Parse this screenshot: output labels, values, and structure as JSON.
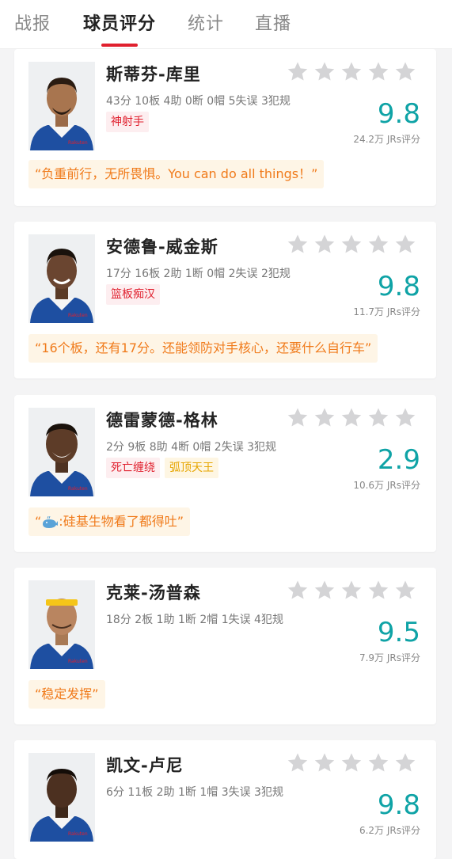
{
  "tabs": [
    {
      "label": "战报"
    },
    {
      "label": "球员评分"
    },
    {
      "label": "统计"
    },
    {
      "label": "直播"
    }
  ],
  "players": [
    {
      "name": "斯蒂芬-库里",
      "stats": "43分 10板 4助 0断 0帽 5失误 3犯规",
      "tags": [
        {
          "text": "神射手",
          "style": "red"
        }
      ],
      "score": "9.8",
      "count": "24.2万 JRs评分",
      "quote": "“负重前行，无所畏惧。You can do all things！”",
      "jersey": "#1e4fa1"
    },
    {
      "name": "安德鲁-威金斯",
      "stats": "17分 16板 2助 1断 0帽 2失误 2犯规",
      "tags": [
        {
          "text": "篮板痴汉",
          "style": "red"
        }
      ],
      "score": "9.8",
      "count": "11.7万 JRs评分",
      "quote": "“16个板，还有17分。还能领防对手核心，还要什么自行车”",
      "jersey": "#1e4fa1"
    },
    {
      "name": "德雷蒙德-格林",
      "stats": "2分 9板 8助 4断 0帽 2失误 3犯规",
      "tags": [
        {
          "text": "死亡缠绕",
          "style": "red"
        },
        {
          "text": "弧顶天王",
          "style": "yellow"
        }
      ],
      "score": "2.9",
      "count": "10.6万 JRs评分",
      "quote": ":硅基生物看了都得吐”",
      "quote_prefix": "“",
      "has_whale": true,
      "jersey": "#1e4fa1"
    },
    {
      "name": "克莱-汤普森",
      "stats": "18分 2板 1助 1断 2帽 1失误 4犯规",
      "tags": [],
      "score": "9.5",
      "count": "7.9万 JRs评分",
      "quote": "“稳定发挥”",
      "jersey": "#1e4fa1"
    },
    {
      "name": "凯文-卢尼",
      "stats": "6分 11板 2助 1断 1帽 3失误 3犯规",
      "tags": [],
      "score": "9.8",
      "count": "6.2万 JRs评分",
      "quote": "",
      "jersey": "#1e4fa1"
    }
  ],
  "colors": {
    "accent": "#e0202e",
    "score": "#0fa3a6",
    "quote_bg": "#fef5e6",
    "quote_text": "#f07a1a",
    "star": "#d4d4d6"
  },
  "icons": {
    "star": "star-icon",
    "whale": "whale-icon"
  }
}
